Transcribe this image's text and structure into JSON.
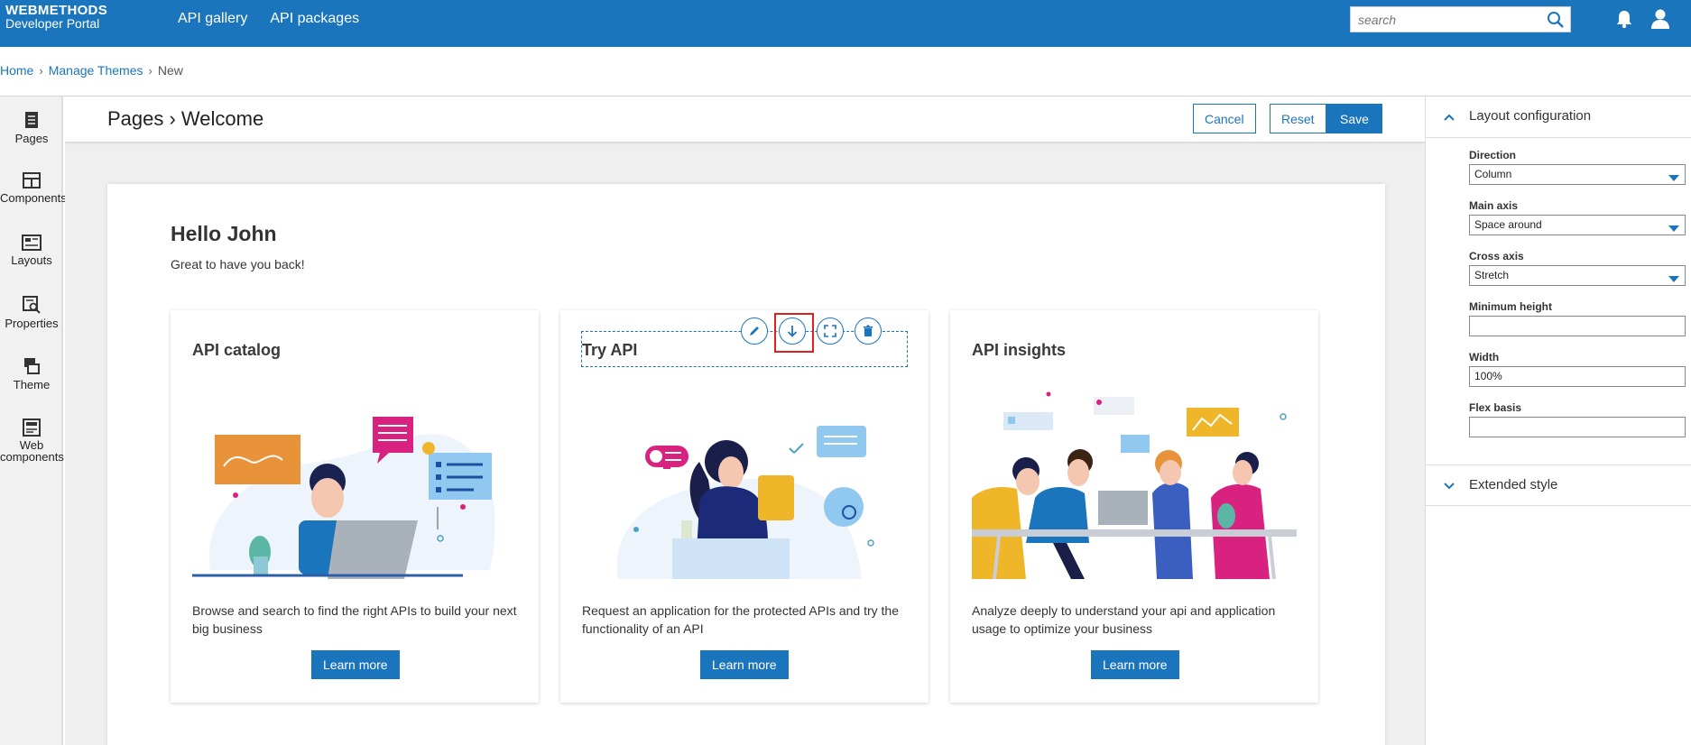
{
  "app": {
    "brand_line1": "WEBMETHODS",
    "brand_line2": "Developer Portal",
    "nav": [
      "API gallery",
      "API packages"
    ],
    "search_placeholder": "search"
  },
  "breadcrumb": {
    "items": [
      "Home",
      "Manage Themes"
    ],
    "current": "New"
  },
  "rail": {
    "items": [
      "Pages",
      "Components",
      "Layouts",
      "Properties",
      "Theme",
      "Web components"
    ]
  },
  "editor": {
    "title": "Pages › Welcome",
    "cancel": "Cancel",
    "reset": "Reset",
    "save": "Save"
  },
  "canvas": {
    "greeting": "Hello John",
    "subtitle": "Great to have you back!",
    "cards": [
      {
        "title": "API catalog",
        "desc": "Browse and search to find the right APIs to build your next big business",
        "button": "Learn more"
      },
      {
        "title": "Try API",
        "desc": "Request an application for the protected APIs and try the functionality of an API",
        "button": "Learn more"
      },
      {
        "title": "API insights",
        "desc": "Analyze deeply to understand your api and application usage to optimize your business",
        "button": "Learn more"
      }
    ]
  },
  "panel": {
    "layout_title": "Layout configuration",
    "direction_label": "Direction",
    "direction_value": "Column",
    "main_axis_label": "Main axis",
    "main_axis_value": "Space around",
    "cross_axis_label": "Cross axis",
    "cross_axis_value": "Stretch",
    "min_height_label": "Minimum height",
    "min_height_value": "",
    "width_label": "Width",
    "width_value": "100%",
    "flex_basis_label": "Flex basis",
    "flex_basis_value": "",
    "extended_title": "Extended style"
  },
  "colors": {
    "primary": "#1b75bc",
    "highlight": "#e02020"
  }
}
